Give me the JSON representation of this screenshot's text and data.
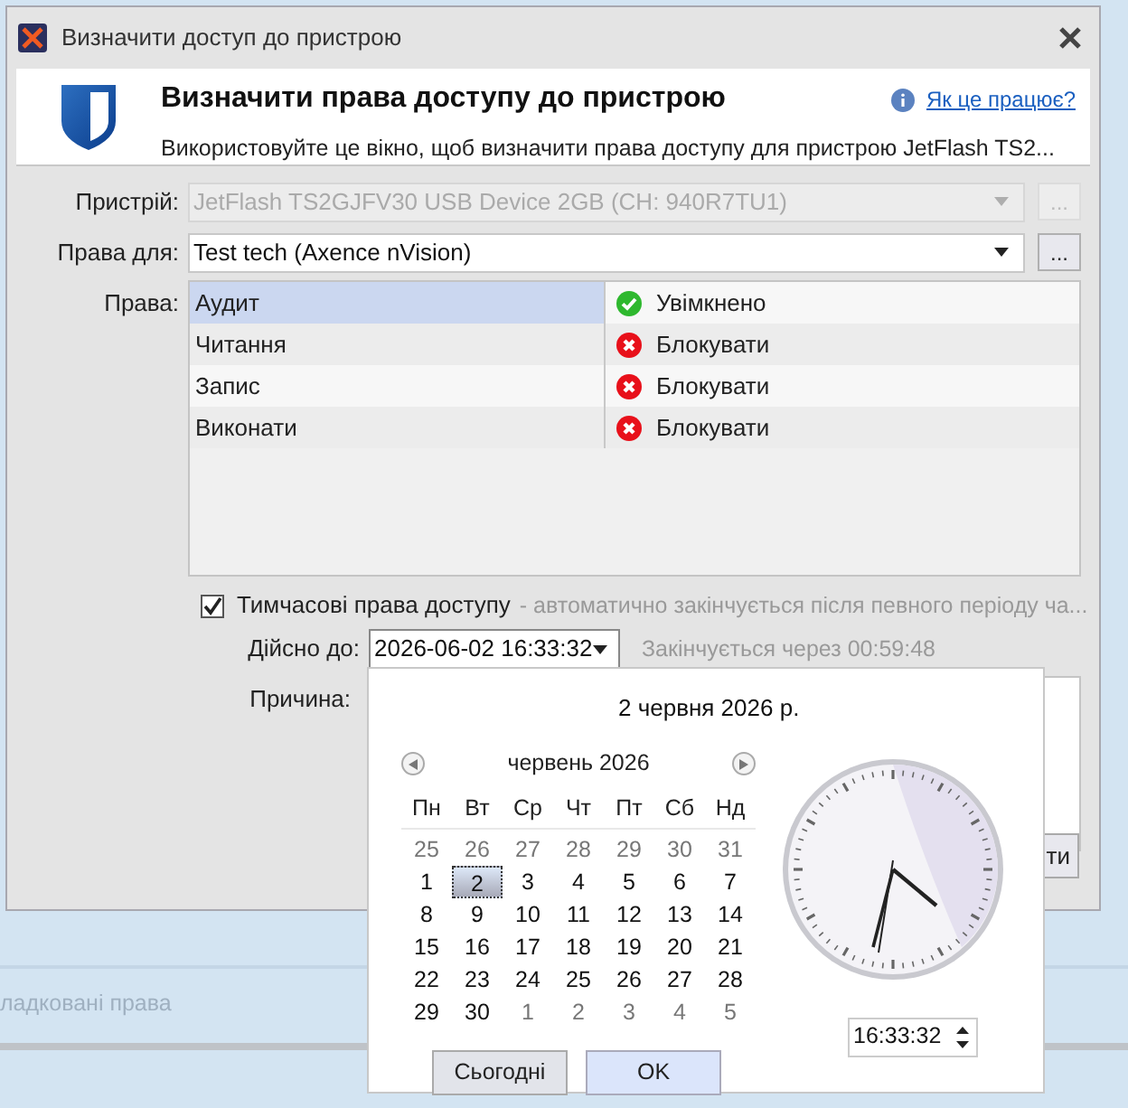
{
  "background": {
    "text": "ладковані права"
  },
  "window": {
    "title": "Визначити доступ до пристрою"
  },
  "header": {
    "title": "Визначити права доступу до пристрою",
    "help_link": "Як це працює?",
    "subtitle": "Використовуйте це вікно, щоб визначити права доступу для пристрою JetFlash TS2..."
  },
  "device": {
    "label": "Пристрій:",
    "value": "JetFlash TS2GJFV30 USB Device 2GB (CH: 940R7TU1)",
    "disabled": true,
    "button": "..."
  },
  "rights_for": {
    "label": "Права для:",
    "value": "Test tech (Axence nVision)",
    "disabled": false,
    "button": "..."
  },
  "rights": {
    "label": "Права:",
    "rows": [
      {
        "name": "Аудит",
        "value": "Увімкнено",
        "kind": "allowed",
        "selected": true
      },
      {
        "name": "Читання",
        "value": "Блокувати",
        "kind": "blocked",
        "selected": false
      },
      {
        "name": "Запис",
        "value": "Блокувати",
        "kind": "blocked",
        "selected": false
      },
      {
        "name": "Виконати",
        "value": "Блокувати",
        "kind": "blocked",
        "selected": false
      }
    ]
  },
  "temporary": {
    "label": "Тимчасові права доступу",
    "hint": "- автоматично закінчується після певного періоду ча...",
    "checked": true
  },
  "valid_until": {
    "label": "Дійсно до:",
    "value": "2026-06-02 16:33:32",
    "expires": "Закінчується через 00:59:48"
  },
  "reason": {
    "label": "Причина:"
  },
  "footer_button": "ти",
  "date_picker": {
    "title": "2 червня 2026 р.",
    "month": "червень 2026",
    "weekdays": [
      "Пн",
      "Вт",
      "Ср",
      "Чт",
      "Пт",
      "Сб",
      "Нд"
    ],
    "weeks": [
      [
        {
          "day": "25",
          "other": true,
          "selected": false
        },
        {
          "day": "26",
          "other": true,
          "selected": false
        },
        {
          "day": "27",
          "other": true,
          "selected": false
        },
        {
          "day": "28",
          "other": true,
          "selected": false
        },
        {
          "day": "29",
          "other": true,
          "selected": false
        },
        {
          "day": "30",
          "other": true,
          "selected": false
        },
        {
          "day": "31",
          "other": true,
          "selected": false
        }
      ],
      [
        {
          "day": "1",
          "other": false,
          "selected": false
        },
        {
          "day": "2",
          "other": false,
          "selected": true
        },
        {
          "day": "3",
          "other": false,
          "selected": false
        },
        {
          "day": "4",
          "other": false,
          "selected": false
        },
        {
          "day": "5",
          "other": false,
          "selected": false
        },
        {
          "day": "6",
          "other": false,
          "selected": false
        },
        {
          "day": "7",
          "other": false,
          "selected": false
        }
      ],
      [
        {
          "day": "8",
          "other": false,
          "selected": false
        },
        {
          "day": "9",
          "other": false,
          "selected": false
        },
        {
          "day": "10",
          "other": false,
          "selected": false
        },
        {
          "day": "11",
          "other": false,
          "selected": false
        },
        {
          "day": "12",
          "other": false,
          "selected": false
        },
        {
          "day": "13",
          "other": false,
          "selected": false
        },
        {
          "day": "14",
          "other": false,
          "selected": false
        }
      ],
      [
        {
          "day": "15",
          "other": false,
          "selected": false
        },
        {
          "day": "16",
          "other": false,
          "selected": false
        },
        {
          "day": "17",
          "other": false,
          "selected": false
        },
        {
          "day": "18",
          "other": false,
          "selected": false
        },
        {
          "day": "19",
          "other": false,
          "selected": false
        },
        {
          "day": "20",
          "other": false,
          "selected": false
        },
        {
          "day": "21",
          "other": false,
          "selected": false
        }
      ],
      [
        {
          "day": "22",
          "other": false,
          "selected": false
        },
        {
          "day": "23",
          "other": false,
          "selected": false
        },
        {
          "day": "24",
          "other": false,
          "selected": false
        },
        {
          "day": "25",
          "other": false,
          "selected": false
        },
        {
          "day": "26",
          "other": false,
          "selected": false
        },
        {
          "day": "27",
          "other": false,
          "selected": false
        },
        {
          "day": "28",
          "other": false,
          "selected": false
        }
      ],
      [
        {
          "day": "29",
          "other": false,
          "selected": false
        },
        {
          "day": "30",
          "other": false,
          "selected": false
        },
        {
          "day": "1",
          "other": true,
          "selected": false
        },
        {
          "day": "2",
          "other": true,
          "selected": false
        },
        {
          "day": "3",
          "other": true,
          "selected": false
        },
        {
          "day": "4",
          "other": true,
          "selected": false
        },
        {
          "day": "5",
          "other": true,
          "selected": false
        }
      ]
    ],
    "today_button": "Сьогодні",
    "ok_button": "OK",
    "time": "16:33:32"
  }
}
